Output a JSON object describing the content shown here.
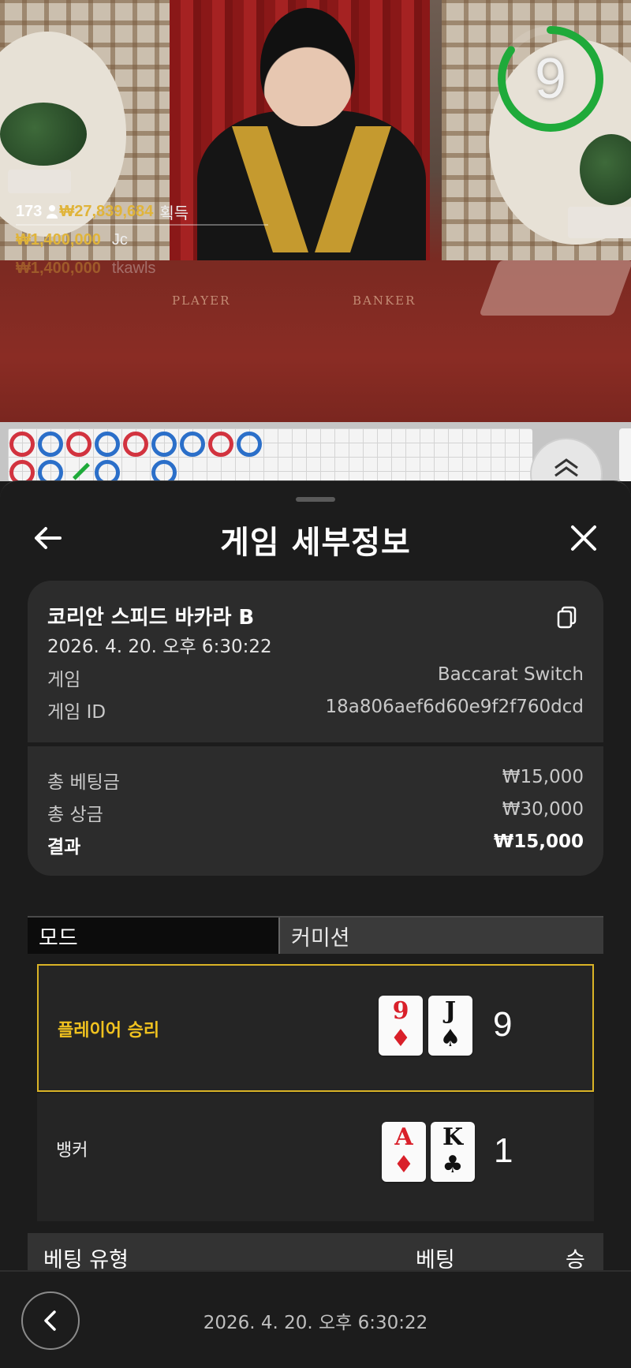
{
  "video": {
    "timer_value": "9",
    "timer_fraction": 0.85,
    "table_labels": {
      "player": "PLAYER",
      "banker": "BANKER"
    },
    "stats": {
      "player_count": "173",
      "total_win": "₩27,839,684",
      "win_label": "획득",
      "win1_amount": "₩1,400,000",
      "win1_user": "Jc",
      "win2_amount": "₩1,400,000",
      "win2_user": "tkawls"
    }
  },
  "road": {
    "beads_row1": [
      "red",
      "blue",
      "red",
      "blue",
      "red",
      "blue",
      "blue",
      "red",
      "blue"
    ],
    "beads_row2": [
      "red",
      "blue",
      "",
      "blue",
      "",
      "blue"
    ]
  },
  "sheet": {
    "title": "게임 세부정보",
    "game_name": "코리안 스피드 바카라 B",
    "datetime": "2026. 4. 20. 오후 6:30:22",
    "game_label": "게임",
    "game_value": "Baccarat Switch",
    "game_id_label": "게임 ID",
    "game_id_value": "18a806aef6d60e9f2f760dcd",
    "total_bet_label": "총 베팅금",
    "total_bet_value": "₩15,000",
    "total_prize_label": "총 상금",
    "total_prize_value": "₩30,000",
    "result_label": "결과",
    "result_value": "₩15,000",
    "mode_tab": "모드",
    "commission_tab": "커미션",
    "player_hand": {
      "label": "플레이어 승리",
      "cards": [
        {
          "rank": "9",
          "suit": "♦",
          "color": "red"
        },
        {
          "rank": "J",
          "suit": "♠",
          "color": "black"
        }
      ],
      "score": "9"
    },
    "banker_hand": {
      "label": "뱅커",
      "cards": [
        {
          "rank": "A",
          "suit": "♦",
          "color": "red"
        },
        {
          "rank": "K",
          "suit": "♣",
          "color": "black"
        }
      ],
      "score": "1"
    },
    "bet_table_headers": {
      "type": "베팅 유형",
      "bet": "베팅",
      "win": "승"
    }
  },
  "bottom_bar": {
    "date": "2026. 4. 20. 오후 6:30:22"
  },
  "colors": {
    "accent_gold": "#f0c21f",
    "timer_green": "#1faa3a",
    "banker_red": "#d2333f",
    "player_blue": "#2b6fc9"
  }
}
